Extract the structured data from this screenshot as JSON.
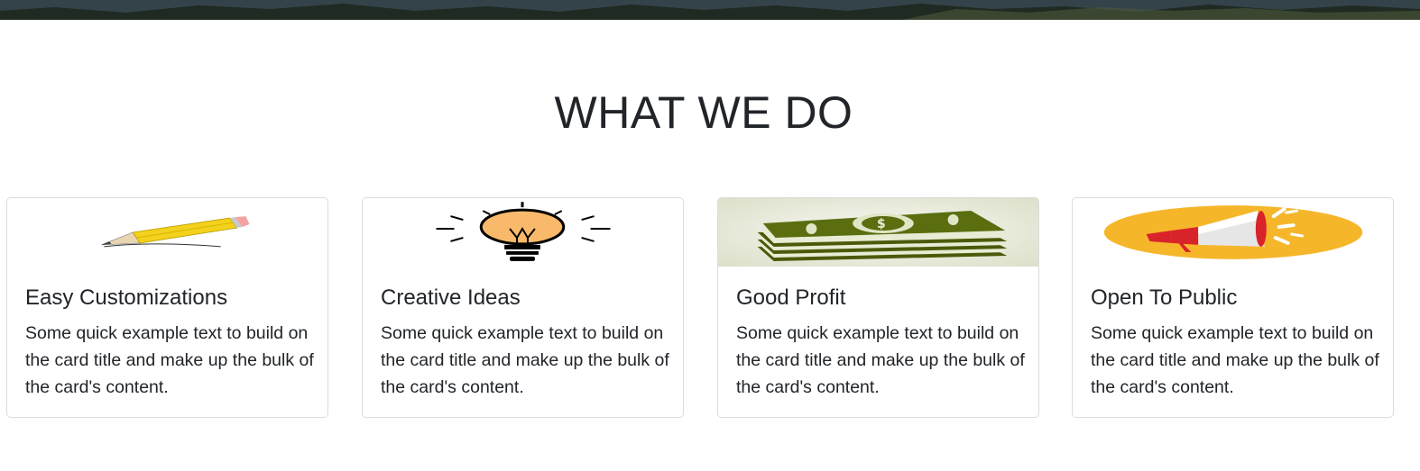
{
  "section": {
    "title": "WHAT WE DO"
  },
  "cards": [
    {
      "title": "Easy Customizations",
      "text": "Some quick example text to build on the card title and make up the bulk of the card's content.",
      "icon": "pencil-icon"
    },
    {
      "title": "Creative Ideas",
      "text": "Some quick example text to build on the card title and make up the bulk of the card's content.",
      "icon": "lightbulb-icon"
    },
    {
      "title": "Good Profit",
      "text": "Some quick example text to build on the card title and make up the bulk of the card's content.",
      "icon": "money-stack-icon"
    },
    {
      "title": "Open To Public",
      "text": "Some quick example text to build on the card title and make up the bulk of the card's content.",
      "icon": "megaphone-icon"
    }
  ],
  "colors": {
    "text": "#212529",
    "card_border": "#dcdcdc",
    "pencil_yellow": "#f2d21c",
    "bulb_orange": "#f9b96b",
    "money_green": "#5a6e10",
    "megaphone_orange": "#f6b62a",
    "megaphone_red": "#d8232a"
  }
}
